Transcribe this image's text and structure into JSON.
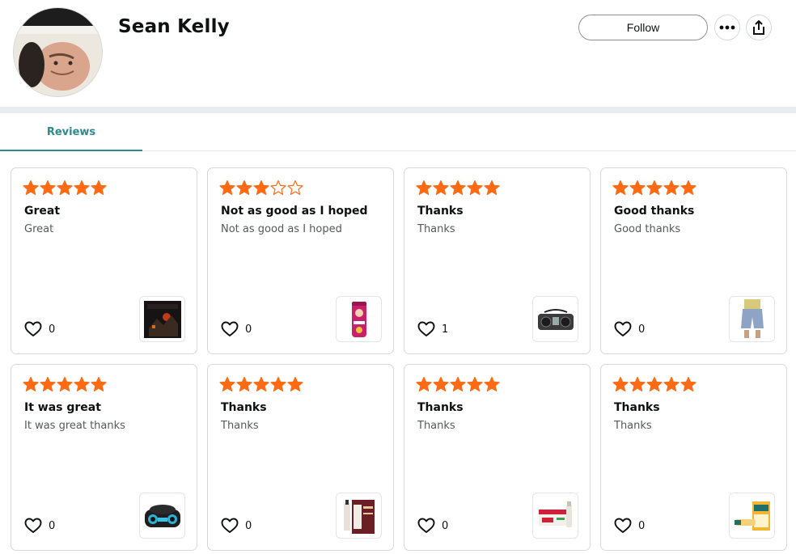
{
  "profile": {
    "name": "Sean Kelly",
    "follow_label": "Follow"
  },
  "tabs": [
    {
      "label": "Reviews",
      "active": true
    }
  ],
  "colors": {
    "star": "#ff6a13",
    "accent": "#2b8a8f"
  },
  "reviews": [
    {
      "rating": 5,
      "title": "Great",
      "body": "Great",
      "likes": "0",
      "product_icon": "dark-album-cover"
    },
    {
      "rating": 3,
      "title": "Not as good as I hoped",
      "body": "Not as good as I hoped",
      "likes": "0",
      "product_icon": "pringles-can"
    },
    {
      "rating": 5,
      "title": "Thanks",
      "body": "Thanks",
      "likes": "1",
      "product_icon": "boombox"
    },
    {
      "rating": 5,
      "title": "Good thanks",
      "body": "Good thanks",
      "likes": "0",
      "product_icon": "denim-shorts"
    },
    {
      "rating": 5,
      "title": "It was great",
      "body": "It was great thanks",
      "likes": "0",
      "product_icon": "cd-player"
    },
    {
      "rating": 5,
      "title": "Thanks",
      "body": "Thanks",
      "likes": "0",
      "product_icon": "polysporin-box"
    },
    {
      "rating": 5,
      "title": "Thanks",
      "body": "Thanks",
      "likes": "0",
      "product_icon": "ointment-box"
    },
    {
      "rating": 5,
      "title": "Thanks",
      "body": "Thanks",
      "likes": "0",
      "product_icon": "neosporin-box"
    }
  ]
}
